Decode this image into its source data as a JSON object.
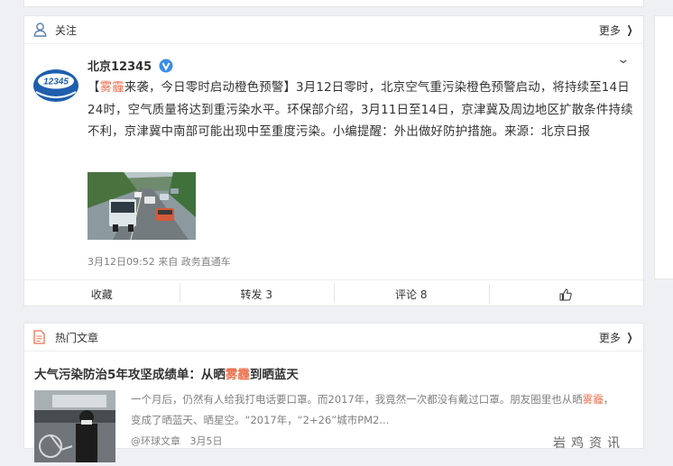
{
  "follow_card": {
    "header_title": "关注",
    "more_label": "更多",
    "post": {
      "avatar_text": "12345",
      "user_name": "北京12345",
      "text": {
        "p1": "【",
        "h1": "雾霾",
        "p2": "来袭，今日零时启动橙色预警】3月12日零时，北京空气重污染橙色预警启动，将持续至14日24时，空气质量将达到重污染水平。环保部介绍，3月11日至14日，京津冀及周边地区扩散条件持续不利，京津冀中南部可能出现中至重度污染。小编提醒：外出做好防护措施。来源：北京日报"
      },
      "time": "3月12日09:52",
      "source_prefix": "来自",
      "source": "政务直通车"
    },
    "actions": {
      "favorite": "收藏",
      "repost": "转发 3",
      "comment": "评论 8"
    }
  },
  "hot_card": {
    "header_title": "热门文章",
    "more_label": "更多",
    "article": {
      "title_p1": "大气污染防治5年攻坚成绩单：从晒",
      "title_h": "雾霾",
      "title_p2": "到晒蓝天",
      "excerpt_p1": "一个月后，仍然有人给我打电话要口罩。而2017年，我竟然一次都没有戴过口罩。朋友圈里也从晒",
      "excerpt_h": "雾霾",
      "excerpt_p2": "，变成了晒蓝天、晒星空。“2017年，“2+26”城市PM2...",
      "meta_author": "@环球文章",
      "meta_date": "3月5日"
    },
    "watermark": "岩鸡资讯"
  },
  "colors": {
    "highlight": "#eb7350",
    "avatar_blue": "#1f5fae",
    "vip_blue": "#3a8ee6"
  }
}
